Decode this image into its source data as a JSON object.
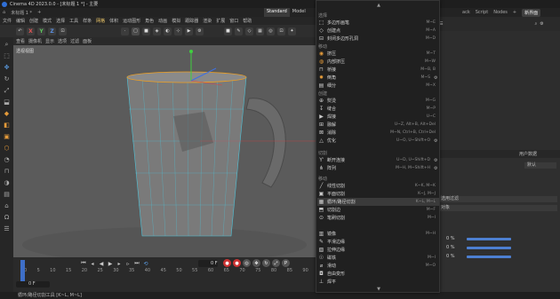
{
  "app": {
    "title": "Cinema 4D 2023.0.0 - [未标题 1 *] - 主要"
  },
  "tabs": [
    "Standard",
    "Model"
  ],
  "doc_tab": "未标题 1 *",
  "right_tabs": [
    "ack",
    "Script",
    "Nodes"
  ],
  "new_scene": "新界面",
  "menubar": [
    "文件",
    "编辑",
    "创建",
    "模式",
    "选择",
    "工具",
    "样条",
    "网格",
    "体积",
    "运动图形",
    "角色",
    "动画",
    "模拟",
    "跟踪器",
    "渲染",
    "扩展",
    "窗口",
    "帮助"
  ],
  "toolbar": {
    "x": "X",
    "y": "Y",
    "z": "Z"
  },
  "viewmenu": [
    "查看",
    "摄像机",
    "显示",
    "选项",
    "过滤",
    "面板"
  ],
  "viewport": {
    "label": "透视视图"
  },
  "timeline": {
    "ticks": [
      "0",
      "5",
      "10",
      "15",
      "20",
      "25",
      "30",
      "35",
      "40",
      "45",
      "50",
      "55",
      "60",
      "65",
      "70",
      "75",
      "80",
      "85",
      "90"
    ],
    "current_frame": "0 F",
    "start": "0 F"
  },
  "status": "循环/路径切割工具 [K~L, M~L]",
  "menu": {
    "sections": {
      "s1": "选择",
      "s2": "移动",
      "s3": "创建",
      "s4": "切割",
      "s5": "移动"
    },
    "items": [
      {
        "icon": "⬚",
        "label": "多边形画笔",
        "shortcut": "M~E"
      },
      {
        "icon": "◇",
        "label": "创建点",
        "shortcut": "M~A"
      },
      {
        "icon": "⊟",
        "label": "封闭多边形孔洞",
        "shortcut": "M~D"
      },
      {
        "icon": "◉",
        "label": "挤压",
        "shortcut": "M~T"
      },
      {
        "icon": "◍",
        "label": "内部挤压",
        "shortcut": "M~W"
      },
      {
        "icon": "⊓",
        "label": "桥接",
        "shortcut": "M~B, B"
      },
      {
        "icon": "✹",
        "label": "倒角",
        "shortcut": "M~S"
      },
      {
        "icon": "▤",
        "label": "细分",
        "shortcut": "M~X"
      },
      {
        "icon": "⊕",
        "label": "熨烫",
        "shortcut": "M~G"
      },
      {
        "icon": "↧",
        "label": "缝合",
        "shortcut": "M~P"
      },
      {
        "icon": "▶",
        "label": "焊接",
        "shortcut": "U~C"
      },
      {
        "icon": "⊞",
        "label": "融解",
        "shortcut": "U~Z, Alt+B, Alt+Del"
      },
      {
        "icon": "⊠",
        "label": "消除",
        "shortcut": "M~N, Ctrl+B, Ctrl+Del"
      },
      {
        "icon": "△",
        "label": "优化",
        "shortcut": "U~O, U~Shift+O"
      },
      {
        "icon": "Ƴ",
        "label": "断开连接",
        "shortcut": "U~D, U~Shift+D"
      },
      {
        "icon": "⋔",
        "label": "阵列",
        "shortcut": "M~H, M~Shift+H"
      },
      {
        "icon": "╱",
        "label": "线性切割",
        "shortcut": "K~K, M~K"
      },
      {
        "icon": "▣",
        "label": "平面切割",
        "shortcut": "K~J, M~J"
      },
      {
        "icon": "▦",
        "label": "循环/路径切割",
        "shortcut": "K~L, M~L"
      },
      {
        "icon": "⬒",
        "label": "切割边",
        "shortcut": "M~F"
      },
      {
        "icon": "⊙",
        "label": "笔刷切割",
        "shortcut": "M~I"
      },
      {
        "icon": "▥",
        "label": "镜像",
        "shortcut": "M~H"
      },
      {
        "icon": "✎",
        "label": "平滑边缘",
        "shortcut": ""
      },
      {
        "icon": "▧",
        "label": "拉伸边缘",
        "shortcut": ""
      },
      {
        "icon": "☉",
        "label": "磁铁",
        "shortcut": "M~I"
      },
      {
        "icon": "⌀",
        "label": "滑动",
        "shortcut": "M~O"
      },
      {
        "icon": "◘",
        "label": "自由变形",
        "shortcut": ""
      },
      {
        "icon": "⊥",
        "label": "焊平",
        "shortcut": ""
      }
    ]
  },
  "attr": {
    "header": "用户数据",
    "mode": "默认",
    "pct": "0 %",
    "pct2": "0 %",
    "pct3": "0 %",
    "dd1": "选用过滤",
    "dd2": "对象"
  }
}
